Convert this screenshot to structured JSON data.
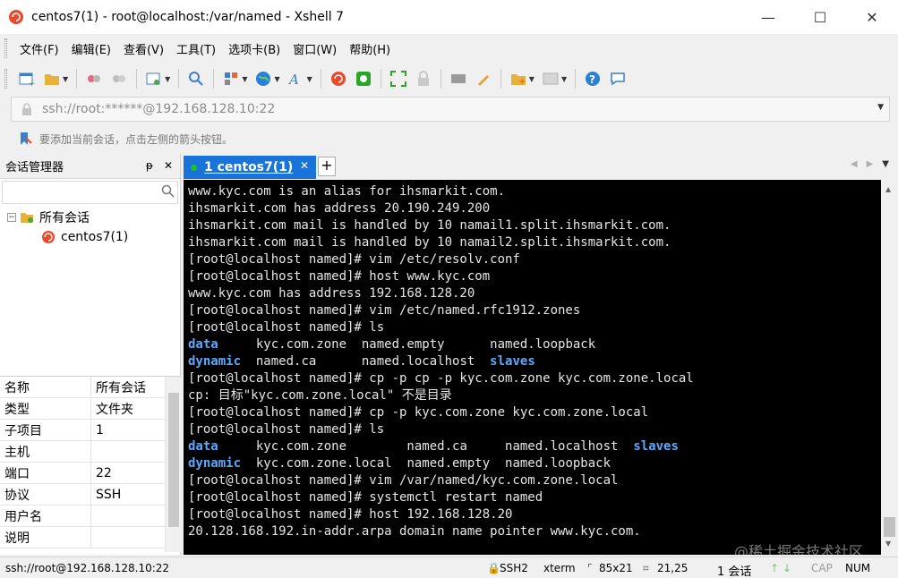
{
  "window": {
    "title": "centos7(1) - root@localhost:/var/named - Xshell 7",
    "controls": {
      "minimize": "—",
      "maximize": "☐",
      "close": "✕"
    }
  },
  "menu": [
    "文件(F)",
    "编辑(E)",
    "查看(V)",
    "工具(T)",
    "选项卡(B)",
    "窗口(W)",
    "帮助(H)"
  ],
  "address": {
    "value": "ssh://root:******@192.168.128.10:22"
  },
  "hint": "要添加当前会话，点击左侧的箭头按钮。",
  "left_panel": {
    "title": "会话管理器",
    "controls": {
      "pin": "ᵽ",
      "close": "✕"
    },
    "tree": {
      "root": "所有会话",
      "child": "centos7(1)",
      "expander": "−"
    },
    "properties": [
      {
        "key": "名称",
        "value": "所有会话"
      },
      {
        "key": "类型",
        "value": "文件夹"
      },
      {
        "key": "子项目",
        "value": "1"
      },
      {
        "key": "主机",
        "value": ""
      },
      {
        "key": "端口",
        "value": "22"
      },
      {
        "key": "协议",
        "value": "SSH"
      },
      {
        "key": "用户名",
        "value": ""
      },
      {
        "key": "说明",
        "value": ""
      }
    ]
  },
  "tabs": {
    "active": "1 centos7(1)",
    "close": "✕",
    "add": "+"
  },
  "terminal": {
    "lines": [
      [
        {
          "t": "www.kyc.com is an alias for ihsmarkit.com."
        }
      ],
      [
        {
          "t": "ihsmarkit.com has address 20.190.249.200"
        }
      ],
      [
        {
          "t": "ihsmarkit.com mail is handled by 10 namail1.split.ihsmarkit.com."
        }
      ],
      [
        {
          "t": "ihsmarkit.com mail is handled by 10 namail2.split.ihsmarkit.com."
        }
      ],
      [
        {
          "t": "[root@localhost named]# vim /etc/resolv.conf"
        }
      ],
      [
        {
          "t": "[root@localhost named]# host www.kyc.com"
        }
      ],
      [
        {
          "t": "www.kyc.com has address 192.168.128.20"
        }
      ],
      [
        {
          "t": "[root@localhost named]# vim /etc/named.rfc1912.zones"
        }
      ],
      [
        {
          "t": "[root@localhost named]# ls"
        }
      ],
      [
        {
          "t": "data",
          "c": "blue"
        },
        {
          "t": "     kyc.com.zone  named.empty      named.loopback"
        }
      ],
      [
        {
          "t": "dynamic",
          "c": "blue"
        },
        {
          "t": "  named.ca      named.localhost  "
        },
        {
          "t": "slaves",
          "c": "blue"
        }
      ],
      [
        {
          "t": "[root@localhost named]# cp -p cp -p kyc.com.zone kyc.com.zone.local"
        }
      ],
      [
        {
          "t": "cp: 目标\"kyc.com.zone.local\" 不是目录"
        }
      ],
      [
        {
          "t": "[root@localhost named]# cp -p kyc.com.zone kyc.com.zone.local"
        }
      ],
      [
        {
          "t": "[root@localhost named]# ls"
        }
      ],
      [
        {
          "t": "data",
          "c": "blue"
        },
        {
          "t": "     kyc.com.zone        named.ca     named.localhost  "
        },
        {
          "t": "slaves",
          "c": "blue"
        }
      ],
      [
        {
          "t": "dynamic",
          "c": "blue"
        },
        {
          "t": "  kyc.com.zone.local  named.empty  named.loopback"
        }
      ],
      [
        {
          "t": "[root@localhost named]# vim /var/named/kyc.com.zone.local"
        }
      ],
      [
        {
          "t": "[root@localhost named]# systemctl restart named"
        }
      ],
      [
        {
          "t": "[root@localhost named]# host 192.168.128.20"
        }
      ],
      [
        {
          "t": "20.128.168.192.in-addr.arpa domain name pointer www.kyc.com."
        }
      ]
    ]
  },
  "status": {
    "address": "ssh://root@192.168.128.10:22",
    "protocol": "SSH2",
    "terminal": "xterm",
    "size": "85x21",
    "position": "21,25",
    "sessions": "1 会话",
    "cap": "CAP",
    "num": "NUM"
  },
  "watermark": "@稀土掘金技术社区",
  "colors": {
    "tab_active": "#1a73d9",
    "terminal_bg": "#000000",
    "terminal_fg": "#e6e6e6",
    "terminal_dir": "#5aa9ff"
  }
}
